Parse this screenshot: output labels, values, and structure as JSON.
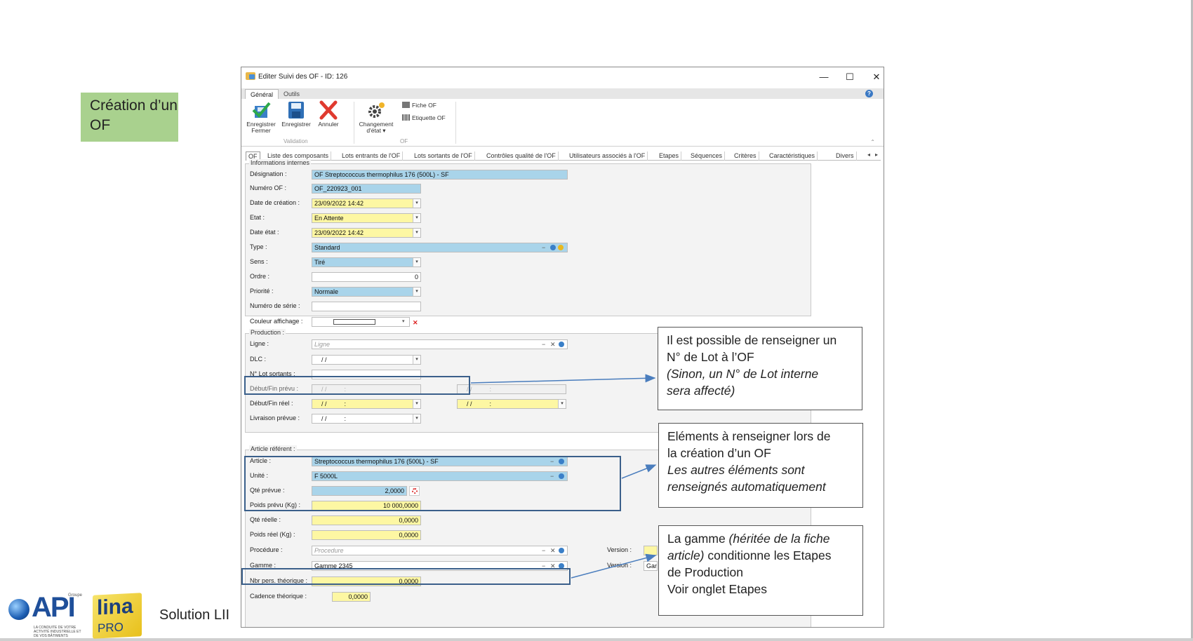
{
  "slide": {
    "title": "Création d’un OF",
    "solution": "Solution LII"
  },
  "logos": {
    "api_text": "API",
    "api_groupe": "Groupe",
    "api_tagline": "LA CONDUITE DE VOTRE ACTIVITÉ INDUSTRIELLE ET DE VOS BÂTIMENTS",
    "lina_text": "lina",
    "pro_text": "PRO"
  },
  "window": {
    "title": "Editer Suivi des OF - ID: 126",
    "minimize": "—",
    "maximize": "☐",
    "close": "✕"
  },
  "ribbon": {
    "tabs": [
      "Général",
      "Outils"
    ],
    "help": "?",
    "buttons": {
      "save_close": "Enregistrer\nFermer",
      "save": "Enregistrer",
      "cancel": "Annuler",
      "change_state": "Changement\nd'état ▾"
    },
    "groups": {
      "validation": "Validation",
      "of": "OF"
    },
    "small": {
      "fiche_of": "Fiche OF",
      "etiquette_of": "Etiquette OF"
    },
    "collapse": "⌃"
  },
  "tabs": [
    "OF",
    "Liste des composants",
    "Lots entrants de l'OF",
    "Lots sortants de l'OF",
    "Contrôles qualité de l'OF",
    "Utilisateurs associés à l'OF",
    "Etapes",
    "Séquences",
    "Critères",
    "Caractéristiques",
    "Divers"
  ],
  "tab_arrows": {
    "left": "◂",
    "right": "▸"
  },
  "infos": {
    "group": "Informations internes",
    "designation_label": "Désignation :",
    "designation": "OF Streptococcus thermophilus 176 (500L) - SF",
    "numero_label": "Numéro OF :",
    "numero": "OF_220923_001",
    "date_creation_label": "Date de création :",
    "date_creation": "23/09/2022 14:42",
    "etat_label": "Etat :",
    "etat": "En Attente",
    "date_etat_label": "Date état :",
    "date_etat": "23/09/2022 14:42",
    "type_label": "Type :",
    "type": "Standard",
    "sens_label": "Sens :",
    "sens": "Tiré",
    "ordre_label": "Ordre :",
    "ordre": "0",
    "priorite_label": "Priorité :",
    "priorite": "Normale",
    "numserie_label": "Numéro de série :",
    "couleur_label": "Couleur affichage :"
  },
  "production": {
    "group": "Production :",
    "ligne_label": "Ligne :",
    "ligne_placeholder": "Ligne",
    "dlc_label": "DLC :",
    "dlc": "/ /",
    "lot_label": "N° Lot sortants :",
    "debut_prevu_label": "Début/Fin prévu :",
    "debut_reel_label": "Début/Fin réel :",
    "livraison_label": "Livraison prévue :",
    "date_empty": "/ /          :"
  },
  "article": {
    "group": "Article référent :",
    "article_label": "Article :",
    "article": "Streptococcus thermophilus 176 (500L) - SF",
    "unite_label": "Unité :",
    "unite": "F 5000L",
    "qte_prevue_label": "Qté prévue :",
    "qte_prevue": "2,0000",
    "poids_prevu_label": "Poids prévu (Kg) :",
    "poids_prevu": "10 000,0000",
    "qte_reelle_label": "Qté réelle :",
    "qte_reelle": "0,0000",
    "poids_reel_label": "Poids réel (Kg) :",
    "poids_reel": "0,0000",
    "procedure_label": "Procédure :",
    "procedure_placeholder": "Procedure",
    "version_label": "Version :",
    "gamme_label": "Gamme :",
    "gamme": "Gamme 2345",
    "version2_label": "Version :",
    "version2_value": "Gam",
    "nbr_label": "Nbr pers. théorique :",
    "nbr": "0,0000",
    "cadence_label": "Cadence théorique :",
    "cadence": "0,0000"
  },
  "mini_icons": {
    "minus": "−",
    "clear": "✕",
    "red_clear": "✕"
  },
  "callouts": {
    "lot": {
      "l1": "Il est possible de renseigner un",
      "l2": "N° de Lot à l’OF",
      "l3": "(Sinon, un N° de Lot interne",
      "l4": "sera affecté)"
    },
    "elements": {
      "l1": "Eléments à renseigner lors de",
      "l2": "la création d’un OF",
      "l3": "Les autres éléments sont",
      "l4": "renseignés automatiquement"
    },
    "gamme": {
      "l1a": "La gamme ",
      "l1b": "(héritée de la fiche",
      "l2a": "article)",
      "l2b": " conditionne les Etapes",
      "l3": "de Production",
      "l4": "Voir onglet Etapes"
    }
  },
  "colors": {
    "field_blue": "#a9d4ea",
    "field_yellow": "#fdf7a3",
    "title_green": "#a9d18e",
    "highlight": "#3a5f8a"
  }
}
